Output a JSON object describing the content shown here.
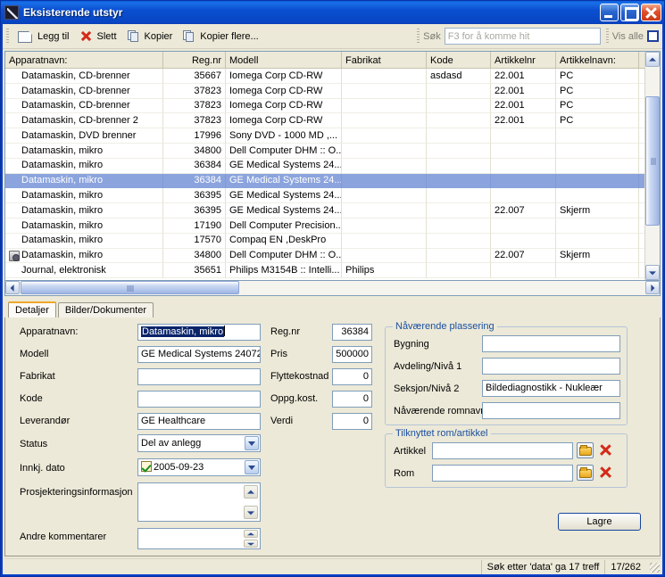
{
  "window": {
    "title": "Eksisterende utstyr",
    "icon": "app-pen-icon",
    "minimize": "minimize-icon",
    "maximize": "maximize-icon",
    "close": "close-icon"
  },
  "toolbar": {
    "add_label": "Legg til",
    "delete_label": "Slett",
    "copy_label": "Kopier",
    "copy_many_label": "Kopier flere...",
    "search_label": "Søk",
    "search_value": "",
    "search_placeholder": "F3 for å komme hit",
    "show_all_label": "Vis alle",
    "show_all_checked": false
  },
  "grid": {
    "columns": [
      {
        "label": "Apparatnavn:",
        "align": "left",
        "width": 177
      },
      {
        "label": "Reg.nr",
        "align": "right",
        "width": 70
      },
      {
        "label": "Modell",
        "align": "left",
        "width": 130
      },
      {
        "label": "Fabrikat",
        "align": "left",
        "width": 95
      },
      {
        "label": "Kode",
        "align": "left",
        "width": 72
      },
      {
        "label": "Artikkelnr",
        "align": "left",
        "width": 73
      },
      {
        "label": "Artikkelnavn:",
        "align": "left",
        "width": 93
      }
    ],
    "rows": [
      {
        "selected": false,
        "icon": "",
        "cells": [
          "Datamaskin, CD-brenner",
          "35667",
          "Iomega Corp CD-RW",
          "",
          "asdasd",
          "22.001",
          "PC"
        ]
      },
      {
        "selected": false,
        "icon": "",
        "cells": [
          "Datamaskin, CD-brenner",
          "37823",
          "Iomega Corp CD-RW",
          "",
          "",
          "22.001",
          "PC"
        ]
      },
      {
        "selected": false,
        "icon": "",
        "cells": [
          "Datamaskin, CD-brenner",
          "37823",
          "Iomega Corp CD-RW",
          "",
          "",
          "22.001",
          "PC"
        ]
      },
      {
        "selected": false,
        "icon": "",
        "cells": [
          "Datamaskin, CD-brenner 2",
          "37823",
          "Iomega Corp CD-RW",
          "",
          "",
          "22.001",
          "PC"
        ]
      },
      {
        "selected": false,
        "icon": "",
        "cells": [
          "Datamaskin, DVD brenner",
          "17996",
          "Sony DVD - 1000 MD ,...",
          "",
          "",
          "",
          ""
        ]
      },
      {
        "selected": false,
        "icon": "",
        "cells": [
          "Datamaskin, mikro",
          "34800",
          "Dell Computer DHM :: O...",
          "",
          "",
          "",
          ""
        ]
      },
      {
        "selected": false,
        "icon": "",
        "cells": [
          "Datamaskin, mikro",
          "36384",
          "GE Medical Systems 24...",
          "",
          "",
          "",
          ""
        ]
      },
      {
        "selected": true,
        "icon": "",
        "cells": [
          "Datamaskin, mikro",
          "36384",
          "GE Medical Systems 24...",
          "",
          "",
          "",
          ""
        ]
      },
      {
        "selected": false,
        "icon": "",
        "cells": [
          "Datamaskin, mikro",
          "36395",
          "GE Medical Systems 24...",
          "",
          "",
          "",
          ""
        ]
      },
      {
        "selected": false,
        "icon": "",
        "cells": [
          "Datamaskin, mikro",
          "36395",
          "GE Medical Systems 24...",
          "",
          "",
          "22.007",
          "Skjerm"
        ]
      },
      {
        "selected": false,
        "icon": "",
        "cells": [
          "Datamaskin, mikro",
          "17190",
          "Dell Computer Precision...",
          "",
          "",
          "",
          ""
        ]
      },
      {
        "selected": false,
        "icon": "",
        "cells": [
          "Datamaskin, mikro",
          "17570",
          "Compaq EN ,DeskPro",
          "",
          "",
          "",
          ""
        ]
      },
      {
        "selected": false,
        "icon": "device-icon",
        "cells": [
          "Datamaskin, mikro",
          "34800",
          "Dell Computer DHM :: O...",
          "",
          "",
          "22.007",
          "Skjerm"
        ]
      },
      {
        "selected": false,
        "icon": "",
        "cells": [
          "Journal, elektronisk",
          "35651",
          "Philips M3154B :: Intelli...",
          "Philips",
          "",
          "",
          ""
        ]
      }
    ]
  },
  "tabs": [
    {
      "label": "Detaljer",
      "active": true
    },
    {
      "label": "Bilder/Dokumenter",
      "active": false
    }
  ],
  "details": {
    "apparatnavn_label": "Apparatnavn:",
    "apparatnavn_value": "Datamaskin, mikro",
    "modell_label": "Modell",
    "modell_value": "GE Medical Systems 24072",
    "fabrikat_label": "Fabrikat",
    "fabrikat_value": "",
    "kode_label": "Kode",
    "kode_value": "",
    "leverandor_label": "Leverandør",
    "leverandor_value": "GE Healthcare",
    "status_label": "Status",
    "status_value": "Del av anlegg",
    "innkj_dato_label": "Innkj. dato",
    "innkj_dato_value": "2005-09-23",
    "innkj_dato_checked": true,
    "prosjektering_label": "Prosjekteringsinformasjon",
    "prosjektering_value": "",
    "andre_kommentarer_label": "Andre kommentarer",
    "andre_kommentarer_value": "",
    "regnr_label": "Reg.nr",
    "regnr_value": "36384",
    "pris_label": "Pris",
    "pris_value": "500000",
    "flyttekostnad_label": "Flyttekostnad",
    "flyttekostnad_value": "0",
    "oppgkost_label": "Oppg.kost.",
    "oppgkost_value": "0",
    "verdi_label": "Verdi",
    "verdi_value": "0"
  },
  "plassering": {
    "title": "Nåværende plassering",
    "bygning_label": "Bygning",
    "bygning_value": "",
    "avdeling_label": "Avdeling/Nivå 1",
    "avdeling_value": "",
    "seksjon_label": "Seksjon/Nivå 2",
    "seksjon_value": "Bildediagnostikk - Nukleær",
    "romnavn_label": "Nåværende romnavn:",
    "romnavn_value": ""
  },
  "tilknyttet": {
    "title": "Tilknyttet rom/artikkel",
    "artikkel_label": "Artikkel",
    "artikkel_value": "",
    "rom_label": "Rom",
    "rom_value": "",
    "browse_icon": "folder-icon",
    "clear_icon": "delete-x-icon"
  },
  "buttons": {
    "save_label": "Lagre"
  },
  "statusbar": {
    "message": "Søk etter 'data' ga 17 treff",
    "position": "17/262"
  },
  "colors": {
    "title_bar": "#0a4fd0",
    "selection": "#8ba4dd",
    "group_title": "#1a4fa0",
    "accent_tab": "#f0a82a",
    "face": "#ece9d8"
  }
}
